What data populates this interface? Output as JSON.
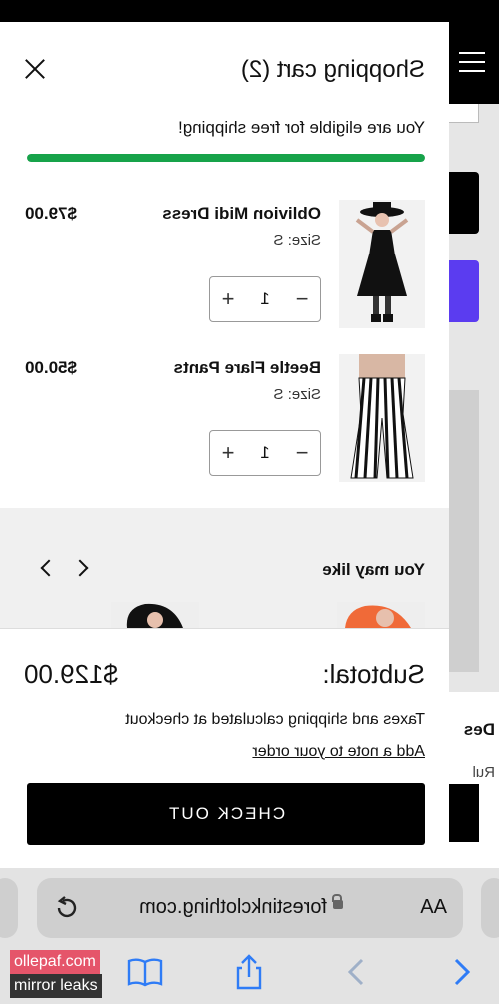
{
  "drawer": {
    "title": "Shopping cart (2)",
    "free_shipping_msg": "You are eligible for free shipping!",
    "free_shipping_progress_percent": 100,
    "items": [
      {
        "name": "Oblivion Midi Dress",
        "size": "Size: S",
        "price": "$79.00",
        "quantity": "1"
      },
      {
        "name": "Beetle Flare Pants",
        "size": "Size: S",
        "price": "$50.00",
        "quantity": "1"
      }
    ],
    "you_may_like": {
      "title": "You may like"
    },
    "footer": {
      "subtotal_label": "Subtotal:",
      "subtotal_value": "$129.00",
      "tax_note": "Taxes and shipping calculated at checkout",
      "note_link": "Add a note to your order",
      "checkout_label": "CHECK OUT"
    }
  },
  "background": {
    "section_label": "Des",
    "text_fragment": "Rul"
  },
  "browser": {
    "aa_label": "AA",
    "url": "forestinkclothing.com",
    "toolbar_icons": [
      "back-icon",
      "forward-icon",
      "share-icon",
      "bookmarks-icon"
    ]
  },
  "watermark": {
    "line1": "ollepaf.com",
    "line2": "mirror leaks"
  },
  "colors": {
    "progress": "#17a34a",
    "accent_purple": "#5b3cf0",
    "checkout_bg": "#000000"
  }
}
